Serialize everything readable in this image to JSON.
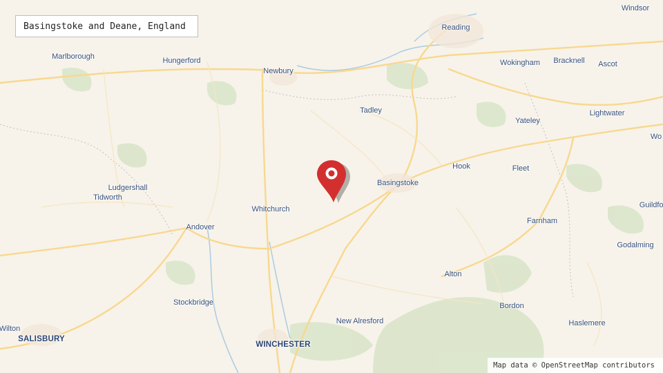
{
  "title": "Basingstoke and Deane, England",
  "attribution": "Map data © OpenStreetMap contributors",
  "marker": {
    "icon": "map-pin-icon",
    "color": "#d32f2f"
  },
  "colors": {
    "land": "#f7f3ea",
    "road": "#f8d88f",
    "forest": "#c8ddb7",
    "water": "#a9cbe3",
    "label": "#36507a"
  },
  "places": {
    "windsor": "Windsor",
    "reading": "Reading",
    "marlborough": "Marlborough",
    "hungerford": "Hungerford",
    "newbury": "Newbury",
    "wokingham": "Wokingham",
    "bracknell": "Bracknell",
    "ascot": "Ascot",
    "tadley": "Tadley",
    "lightwater": "Lightwater",
    "yateley": "Yateley",
    "wo": "Wo",
    "hook": "Hook",
    "fleet": "Fleet",
    "basingstoke": "Basingstoke",
    "ludgershall": "Ludgershall",
    "tidworth": "Tidworth",
    "whitchurch": "Whitchurch",
    "guildford": "Guildfor",
    "andover": "Andover",
    "farnham": "Farnham",
    "godalming": "Godalming",
    "alton": "Alton",
    "stockbridge": "Stockbridge",
    "bordon": "Bordon",
    "new_alresford": "New Alresford",
    "haslemere": "Haslemere",
    "wilton": "Wilton",
    "salisbury": "SALISBURY",
    "winchester": "WINCHESTER"
  }
}
